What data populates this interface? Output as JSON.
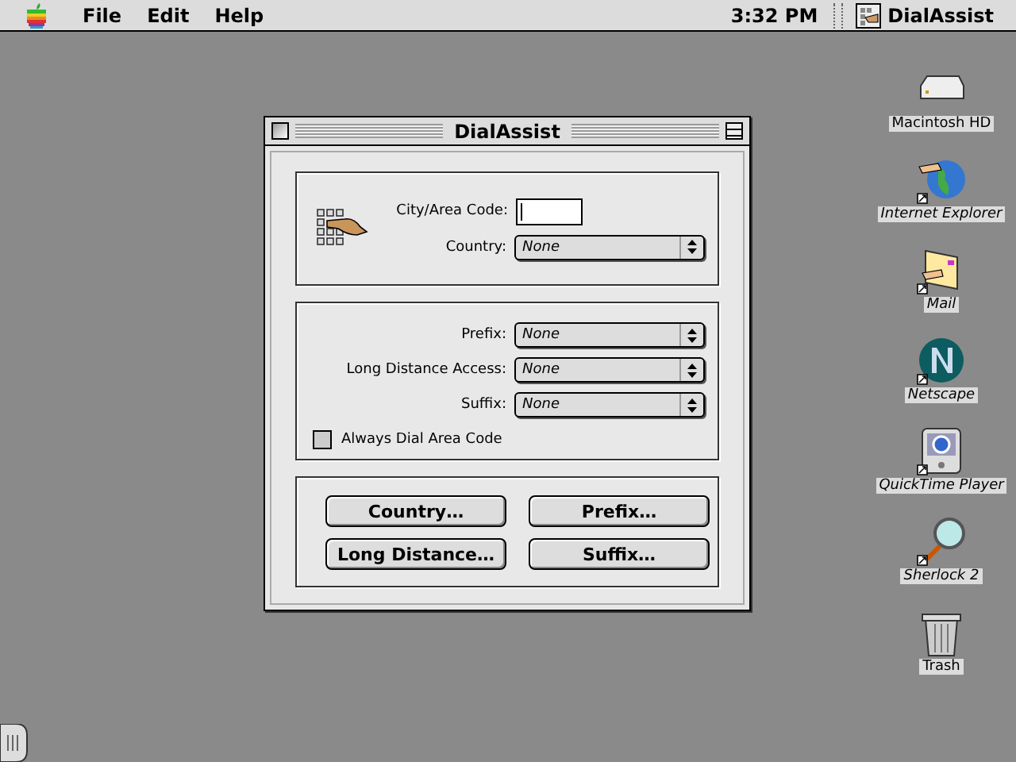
{
  "menu_bar": {
    "menus": [
      "File",
      "Edit",
      "Help"
    ],
    "clock": "3:32 PM",
    "app": "DialAssist"
  },
  "window": {
    "title": "DialAssist",
    "area_fields": [
      {
        "kind": "text",
        "label": "City/Area Code:"
      },
      {
        "kind": "popup",
        "label": "Country:",
        "value": "None"
      }
    ],
    "dial_fields": [
      {
        "kind": "popup",
        "label": "Prefix:",
        "value": "None"
      },
      {
        "kind": "popup",
        "label": "Long Distance Access:",
        "value": "None"
      },
      {
        "kind": "popup",
        "label": "Suffix:",
        "value": "None"
      }
    ],
    "checkbox": {
      "label": "Always Dial Area Code",
      "checked": false
    },
    "buttons": [
      "Country…",
      "Prefix…",
      "Long Distance…",
      "Suffix…"
    ]
  },
  "desktop_icons": [
    {
      "kind": "disk",
      "label": "Macintosh HD"
    },
    {
      "kind": "globe",
      "label": "Internet Explorer"
    },
    {
      "kind": "mail",
      "label": "Mail"
    },
    {
      "kind": "netscape",
      "label": "Netscape"
    },
    {
      "kind": "player",
      "label": "QuickTime Player"
    },
    {
      "kind": "magnifier",
      "label": "Sherlock 2"
    },
    {
      "kind": "trash",
      "label": "Trash"
    }
  ]
}
